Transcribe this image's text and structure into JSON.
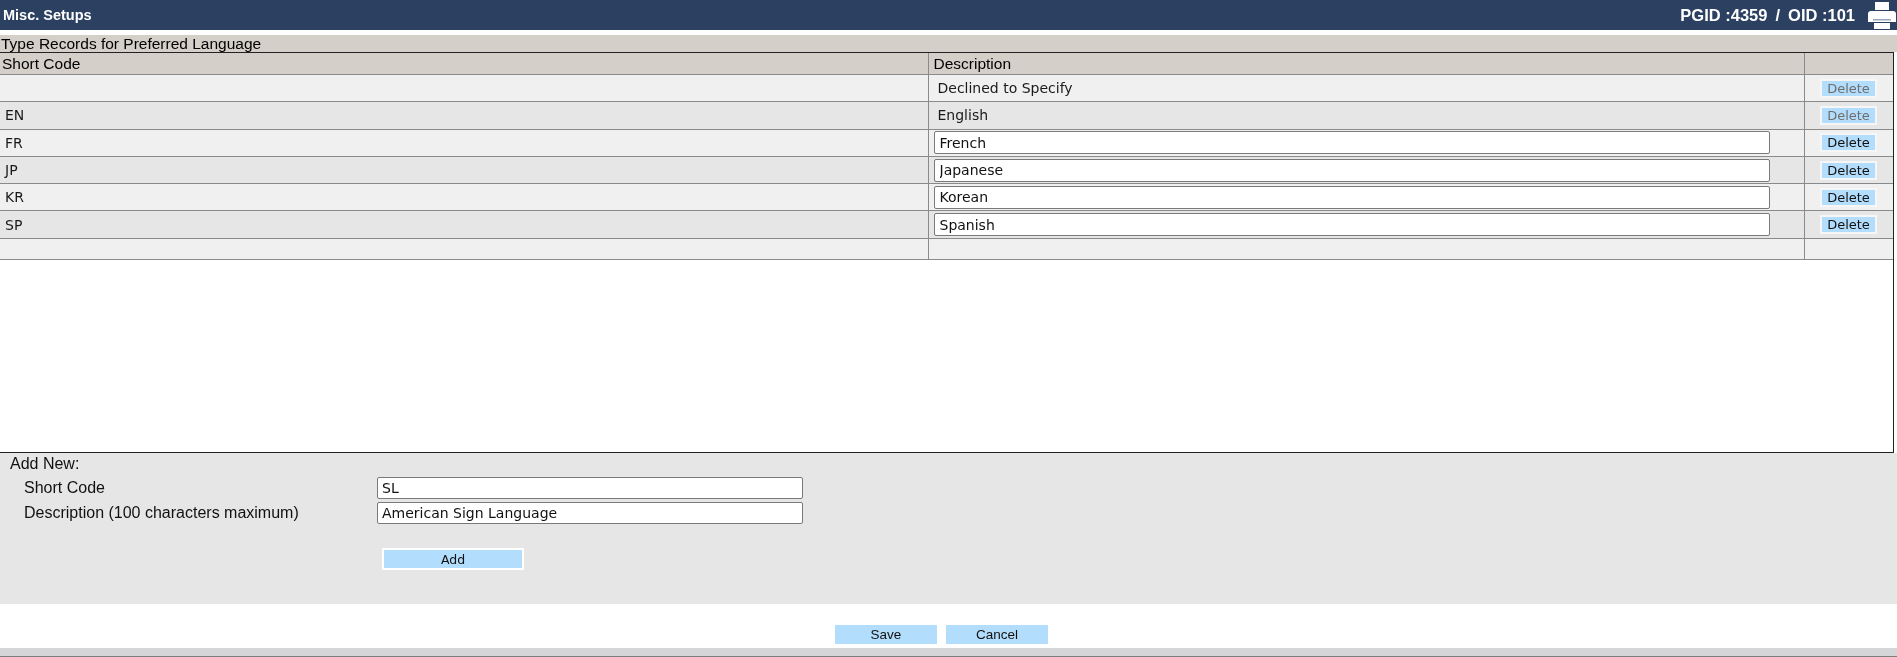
{
  "header": {
    "title": "Misc. Setups",
    "page_id": "PGID :4359",
    "separator": "/",
    "object_id": "OID :101"
  },
  "table": {
    "title": "Type Records for Preferred Language",
    "columns": [
      "Short Code",
      "Description"
    ],
    "rows": [
      {
        "description": "Declined to Specify",
        "editable": false,
        "delete": {
          "label": "Delete",
          "disabled": true
        }
      },
      {
        "short_code": "EN",
        "description": "English",
        "editable": false,
        "delete": {
          "label": "Delete",
          "disabled": true
        }
      },
      {
        "short_code": "FR",
        "description": "French",
        "editable": true,
        "delete": {
          "label": "Delete",
          "disabled": false
        }
      },
      {
        "short_code": "JP",
        "description": "Japanese",
        "editable": true,
        "delete": {
          "label": "Delete",
          "disabled": false
        }
      },
      {
        "short_code": "KR",
        "description": "Korean",
        "editable": true,
        "delete": {
          "label": "Delete",
          "disabled": false
        }
      },
      {
        "short_code": "SP",
        "description": "Spanish",
        "editable": true,
        "delete": {
          "label": "Delete",
          "disabled": false
        }
      }
    ]
  },
  "add_new": {
    "title": "Add New:",
    "fields": [
      {
        "label": "Short Code",
        "value": "SL"
      },
      {
        "label": "Description (100 characters maximum)",
        "value": "American Sign Language"
      }
    ],
    "button": "Add"
  },
  "buttons": [
    "Save",
    "Cancel"
  ]
}
